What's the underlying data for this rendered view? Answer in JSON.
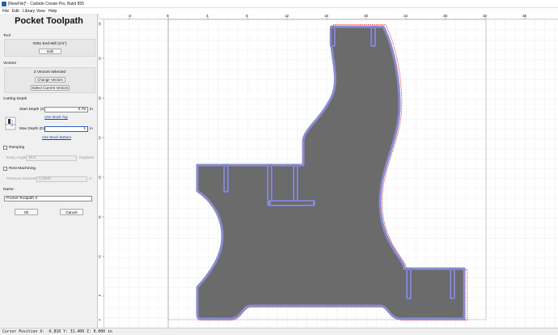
{
  "window": {
    "title": "[NewFile]* - Carbide Create Pro, Build 855"
  },
  "menu": {
    "items": [
      "File",
      "Edit",
      "Library",
      "View",
      "Help"
    ]
  },
  "panel": {
    "title": "Pocket Toolpath",
    "tool": {
      "label": "Tool",
      "name": "#251 End Mill (1/4\")",
      "edit": "Edit"
    },
    "vectors": {
      "label": "Vectors",
      "count": "2 Vectors selected",
      "change": "Change Vectors",
      "select": "Select Current Vectors"
    },
    "depth": {
      "label": "Cutting Depth",
      "start_label": "Start Depth (S)",
      "start_value": "0.75",
      "max_label": "Max Depth (D)",
      "max_value": "1",
      "unit": "in",
      "stock_top": "Use Stock Top",
      "stock_bottom": "Use Stock Bottom"
    },
    "ramping": {
      "label": "Ramping",
      "angle_label": "Entry Angle",
      "angle_value": "20.0",
      "angle_unit": "Degrees",
      "checked": false
    },
    "rest": {
      "label": "Rest Machining",
      "diam_label": "Previous Diameter",
      "diam_value": "0.2500",
      "unit": "in",
      "checked": false
    },
    "name": {
      "label": "Name",
      "value": "Pocket Toolpath 3"
    },
    "ok": "Ok",
    "cancel": "Cancel"
  },
  "status": {
    "text": "Cursor Position X: -6.810 Y: 31.400 Z: 0.000 in"
  },
  "rulers": {
    "h": [
      "-4",
      "0",
      "4",
      "8",
      "12",
      "16",
      "20",
      "24",
      "28",
      "32",
      "36"
    ],
    "v": [
      "36",
      "32",
      "28",
      "24",
      "20",
      "16",
      "12",
      "8",
      "4",
      "0"
    ]
  },
  "colors": {
    "pocket_fill": "#6b6b6b",
    "toolpath": "#8b8bd0",
    "outline_red": "#e02020",
    "outline_blue": "#3a3aff",
    "grid": "#d9d9d9",
    "grid_major": "#cfcfcf"
  }
}
